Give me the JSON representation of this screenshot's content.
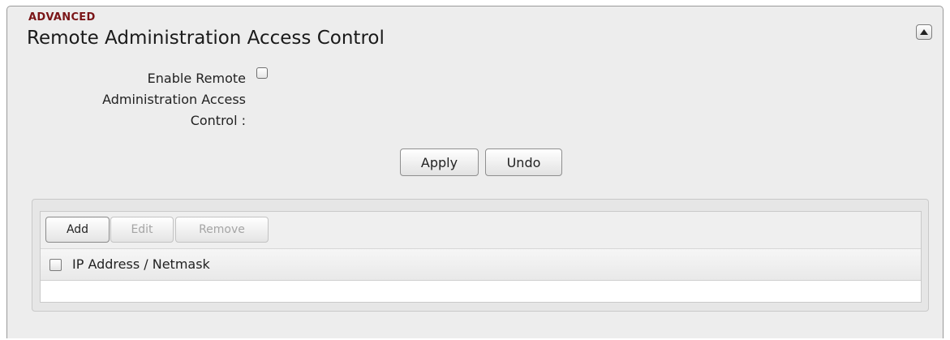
{
  "section": {
    "tag": "ADVANCED",
    "title": "Remote Administration Access Control"
  },
  "icons": {
    "collapse": "triangle-up-icon"
  },
  "form": {
    "enable_label": "Enable Remote Administration Access Control :",
    "enable_checked": false
  },
  "actions": {
    "apply_label": "Apply",
    "undo_label": "Undo"
  },
  "grid": {
    "toolbar": {
      "add_label": "Add",
      "edit_label": "Edit",
      "remove_label": "Remove",
      "edit_enabled": false,
      "remove_enabled": false
    },
    "columns": [
      "IP Address / Netmask"
    ],
    "select_all_checked": false,
    "rows": []
  },
  "colors": {
    "section_tag": "#7a1517",
    "panel_bg": "#ededed",
    "disabled_text": "#a5a5a5"
  }
}
